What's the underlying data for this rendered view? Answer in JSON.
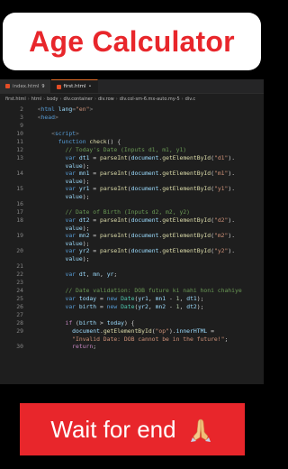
{
  "title_banner": {
    "text": "Age Calculator"
  },
  "editor": {
    "tabs": [
      {
        "label": "index.html",
        "badge": "9",
        "active": false
      },
      {
        "label": "first.html",
        "badge": "•",
        "active": true
      }
    ],
    "breadcrumb": [
      "first.html",
      "html",
      "body",
      "div.container",
      "div.row",
      "div.col-sm-6.mx-auto.my-5",
      "div.c"
    ],
    "lines": [
      {
        "n": "2",
        "tokens": [
          [
            "t",
            "  <"
          ],
          [
            "tn",
            "html"
          ],
          [
            "a",
            " lang"
          ],
          [
            "t",
            "="
          ],
          [
            "s",
            "\"en\""
          ],
          [
            "t",
            ">"
          ]
        ]
      },
      {
        "n": "3",
        "tokens": [
          [
            "t",
            "  <"
          ],
          [
            "tn",
            "head"
          ],
          [
            "t",
            ">"
          ]
        ]
      },
      {
        "n": "9",
        "tokens": []
      },
      {
        "n": "10",
        "tokens": [
          [
            "t",
            "      <"
          ],
          [
            "tn",
            "script"
          ],
          [
            "t",
            ">"
          ]
        ]
      },
      {
        "n": "11",
        "tokens": [
          [
            "k",
            "        function "
          ],
          [
            "f",
            "check"
          ],
          [
            "p",
            "() {"
          ]
        ]
      },
      {
        "n": "12",
        "tokens": [
          [
            "c",
            "          // Today's Date (Inputs d1, m1, y1)"
          ]
        ]
      },
      {
        "n": "13",
        "tokens": [
          [
            "k",
            "          var "
          ],
          [
            "v",
            "dt1"
          ],
          [
            "p",
            " = "
          ],
          [
            "f",
            "parseInt"
          ],
          [
            "p",
            "("
          ],
          [
            "v",
            "document"
          ],
          [
            "p",
            "."
          ],
          [
            "f",
            "getElementById"
          ],
          [
            "p",
            "("
          ],
          [
            "s",
            "\"d1\""
          ],
          [
            "p",
            ")."
          ]
        ],
        "cont": [
          [
            "v",
            "          value"
          ],
          [
            "p",
            ");"
          ]
        ]
      },
      {
        "n": "14",
        "tokens": [
          [
            "k",
            "          var "
          ],
          [
            "v",
            "mn1"
          ],
          [
            "p",
            " = "
          ],
          [
            "f",
            "parseInt"
          ],
          [
            "p",
            "("
          ],
          [
            "v",
            "document"
          ],
          [
            "p",
            "."
          ],
          [
            "f",
            "getElementById"
          ],
          [
            "p",
            "("
          ],
          [
            "s",
            "\"m1\""
          ],
          [
            "p",
            ")."
          ]
        ],
        "cont": [
          [
            "v",
            "          value"
          ],
          [
            "p",
            ");"
          ]
        ]
      },
      {
        "n": "15",
        "tokens": [
          [
            "k",
            "          var "
          ],
          [
            "v",
            "yr1"
          ],
          [
            "p",
            " = "
          ],
          [
            "f",
            "parseInt"
          ],
          [
            "p",
            "("
          ],
          [
            "v",
            "document"
          ],
          [
            "p",
            "."
          ],
          [
            "f",
            "getElementById"
          ],
          [
            "p",
            "("
          ],
          [
            "s",
            "\"y1\""
          ],
          [
            "p",
            ")."
          ]
        ],
        "cont": [
          [
            "v",
            "          value"
          ],
          [
            "p",
            ");"
          ]
        ]
      },
      {
        "n": "16",
        "tokens": []
      },
      {
        "n": "17",
        "tokens": [
          [
            "c",
            "          // Date of Birth (Inputs d2, m2, y2)"
          ]
        ]
      },
      {
        "n": "18",
        "tokens": [
          [
            "k",
            "          var "
          ],
          [
            "v",
            "dt2"
          ],
          [
            "p",
            " = "
          ],
          [
            "f",
            "parseInt"
          ],
          [
            "p",
            "("
          ],
          [
            "v",
            "document"
          ],
          [
            "p",
            "."
          ],
          [
            "f",
            "getElementById"
          ],
          [
            "p",
            "("
          ],
          [
            "s",
            "\"d2\""
          ],
          [
            "p",
            ")."
          ]
        ],
        "cont": [
          [
            "v",
            "          value"
          ],
          [
            "p",
            ");"
          ]
        ]
      },
      {
        "n": "19",
        "tokens": [
          [
            "k",
            "          var "
          ],
          [
            "v",
            "mn2"
          ],
          [
            "p",
            " = "
          ],
          [
            "f",
            "parseInt"
          ],
          [
            "p",
            "("
          ],
          [
            "v",
            "document"
          ],
          [
            "p",
            "."
          ],
          [
            "f",
            "getElementById"
          ],
          [
            "p",
            "("
          ],
          [
            "s",
            "\"m2\""
          ],
          [
            "p",
            ")."
          ]
        ],
        "cont": [
          [
            "v",
            "          value"
          ],
          [
            "p",
            ");"
          ]
        ]
      },
      {
        "n": "20",
        "tokens": [
          [
            "k",
            "          var "
          ],
          [
            "v",
            "yr2"
          ],
          [
            "p",
            " = "
          ],
          [
            "f",
            "parseInt"
          ],
          [
            "p",
            "("
          ],
          [
            "v",
            "document"
          ],
          [
            "p",
            "."
          ],
          [
            "f",
            "getElementById"
          ],
          [
            "p",
            "("
          ],
          [
            "s",
            "\"y2\""
          ],
          [
            "p",
            ")."
          ]
        ],
        "cont": [
          [
            "v",
            "          value"
          ],
          [
            "p",
            ");"
          ]
        ]
      },
      {
        "n": "21",
        "tokens": []
      },
      {
        "n": "22",
        "tokens": [
          [
            "k",
            "          var "
          ],
          [
            "v",
            "dt"
          ],
          [
            "p",
            ", "
          ],
          [
            "v",
            "mn"
          ],
          [
            "p",
            ", "
          ],
          [
            "v",
            "yr"
          ],
          [
            "p",
            ";"
          ]
        ]
      },
      {
        "n": "23",
        "tokens": []
      },
      {
        "n": "24",
        "tokens": [
          [
            "c",
            "          // Date validation: DOB future ki nahi honi chahiye"
          ]
        ]
      },
      {
        "n": "25",
        "tokens": [
          [
            "k",
            "          var "
          ],
          [
            "v",
            "today"
          ],
          [
            "p",
            " = "
          ],
          [
            "k",
            "new "
          ],
          [
            "cls",
            "Date"
          ],
          [
            "p",
            "("
          ],
          [
            "v",
            "yr1"
          ],
          [
            "p",
            ", "
          ],
          [
            "v",
            "mn1"
          ],
          [
            "p",
            " - "
          ],
          [
            "n",
            "1"
          ],
          [
            "p",
            ", "
          ],
          [
            "v",
            "dt1"
          ],
          [
            "p",
            ");"
          ]
        ]
      },
      {
        "n": "26",
        "tokens": [
          [
            "k",
            "          var "
          ],
          [
            "v",
            "birth"
          ],
          [
            "p",
            " = "
          ],
          [
            "k",
            "new "
          ],
          [
            "cls",
            "Date"
          ],
          [
            "p",
            "("
          ],
          [
            "v",
            "yr2"
          ],
          [
            "p",
            ", "
          ],
          [
            "v",
            "mn2"
          ],
          [
            "p",
            " - "
          ],
          [
            "n",
            "1"
          ],
          [
            "p",
            ", "
          ],
          [
            "v",
            "dt2"
          ],
          [
            "p",
            ");"
          ]
        ]
      },
      {
        "n": "27",
        "tokens": []
      },
      {
        "n": "28",
        "tokens": [
          [
            "kc",
            "          if "
          ],
          [
            "p",
            "("
          ],
          [
            "v",
            "birth"
          ],
          [
            "p",
            " > "
          ],
          [
            "v",
            "today"
          ],
          [
            "p",
            ") {"
          ]
        ]
      },
      {
        "n": "29",
        "tokens": [
          [
            "v",
            "            document"
          ],
          [
            "p",
            "."
          ],
          [
            "f",
            "getElementById"
          ],
          [
            "p",
            "("
          ],
          [
            "s",
            "\"op\""
          ],
          [
            "p",
            ")."
          ],
          [
            "v",
            "innerHTML"
          ],
          [
            "p",
            " ="
          ]
        ],
        "cont": [
          [
            "s",
            "            \"Invalid Date: DOB cannot be in the future!\""
          ],
          [
            "p",
            ";"
          ]
        ]
      },
      {
        "n": "30",
        "tokens": [
          [
            "kc",
            "            return"
          ],
          [
            "p",
            ";"
          ]
        ]
      }
    ]
  },
  "wait_banner": {
    "text": "Wait for end",
    "icon": "folded-hands-icon"
  },
  "colors": {
    "accent_red": "#e8262b",
    "editor_bg": "#1e1e1e",
    "keyword": "#569cd6",
    "function": "#dcdcaa",
    "variable": "#9cdcfe",
    "string": "#ce9178",
    "comment": "#6a9955"
  }
}
